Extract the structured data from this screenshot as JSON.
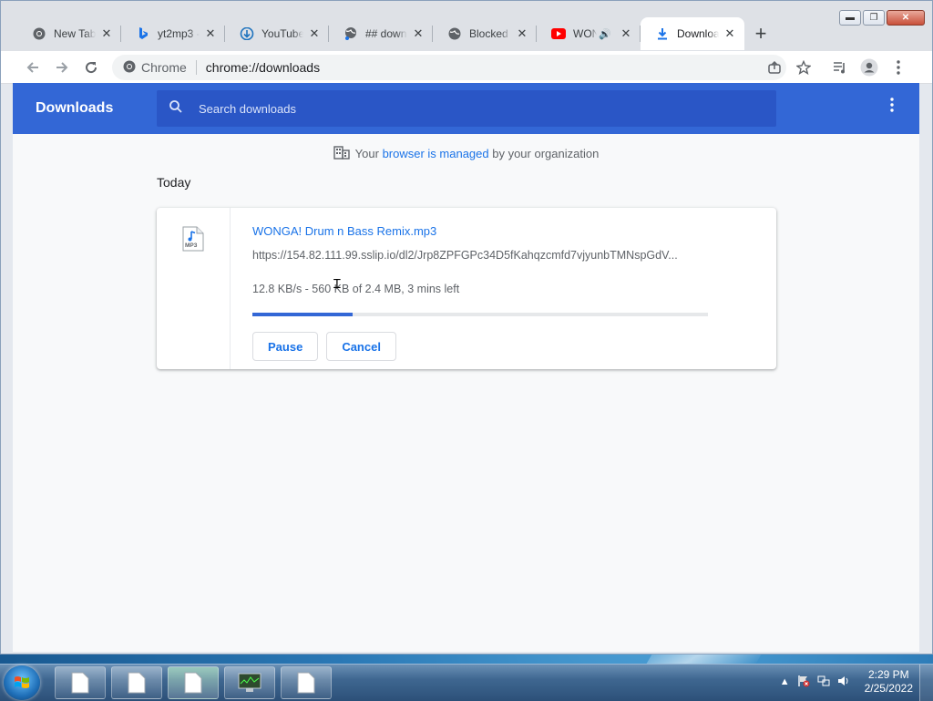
{
  "browser": {
    "tabs": [
      {
        "title": "New Tab",
        "icon": "chrome-icon"
      },
      {
        "title": "yt2mp3 -",
        "icon": "bing-icon"
      },
      {
        "title": "YouTube",
        "icon": "download-cloud-icon"
      },
      {
        "title": "## down",
        "icon": "globe-icon"
      },
      {
        "title": "Blocked b",
        "icon": "globe-icon"
      },
      {
        "title": "WON",
        "icon": "youtube-icon"
      },
      {
        "title": "Downloa",
        "icon": "download-icon"
      }
    ],
    "omnibox": {
      "chip": "Chrome",
      "url": "chrome://downloads"
    }
  },
  "downloads": {
    "title": "Downloads",
    "search_placeholder": "Search downloads",
    "managed_prefix": "Your ",
    "managed_link": "browser is managed",
    "managed_suffix": " by your organization",
    "section_date": "Today",
    "item": {
      "filename": "WONGA! Drum n Bass Remix.mp3",
      "url": "https://154.82.111.99.sslip.io/dl2/Jrp8ZPFGPc34D5fKahqzcmfd7vjyunbTMNspGdV...",
      "status": "12.8 KB/s - 560 KB of 2.4 MB, 3 mins left",
      "progress": 0.22,
      "file_type": "MP3",
      "pause_label": "Pause",
      "cancel_label": "Cancel"
    }
  },
  "taskbar": {
    "time": "2:29 PM",
    "date": "2/25/2022"
  },
  "colors": {
    "header_blue": "#3367d6",
    "link_blue": "#1a73e8"
  }
}
